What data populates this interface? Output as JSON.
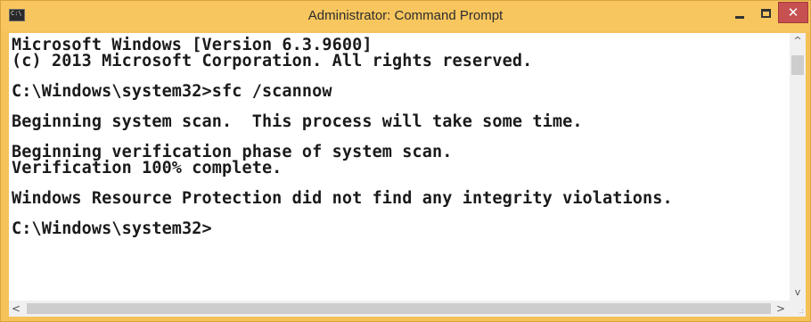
{
  "window": {
    "title": "Administrator: Command Prompt",
    "app_icon_text": "C:\\",
    "controls": {
      "close_glyph": "✕"
    },
    "colors": {
      "frame": "#f5c25a",
      "close_button": "#c75050",
      "console_background": "#ffffff",
      "console_text": "#1a1a1a"
    }
  },
  "console": {
    "lines": [
      "Microsoft Windows [Version 6.3.9600]",
      "(c) 2013 Microsoft Corporation. All rights reserved.",
      "C:\\Windows\\system32>sfc /scannow",
      "Beginning system scan.  This process will take some time.",
      "Beginning verification phase of system scan.",
      "Verification 100% complete.",
      "Windows Resource Protection did not find any integrity violations.",
      "C:\\Windows\\system32>"
    ]
  },
  "scrollbars": {
    "up_arrow": "^",
    "down_arrow": "v",
    "left_arrow": "<",
    "right_arrow": ">",
    "grip": ".:"
  },
  "icons": {
    "app": "console-app-icon",
    "minimize": "minimize-icon",
    "maximize": "maximize-icon",
    "close": "close-icon"
  }
}
